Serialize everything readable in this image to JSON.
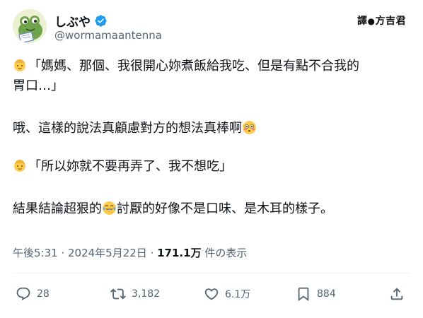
{
  "author": {
    "display_name": "しぶや",
    "handle": "@wormamaantenna",
    "avatar_icon": "frog-reading-avatar",
    "verified_icon": "verified-badge-icon",
    "verified_color": "#1d9bf0"
  },
  "watermark": {
    "prefix": "譯",
    "separator": "●",
    "name": "方吉君"
  },
  "tweet": {
    "line1": "「媽媽、那個、我很開心妳煮飯給我吃、但是有點不合我的",
    "line2": "胃口…」",
    "line3": "哦、這樣的說法真顧慮對方的想法真棒啊",
    "line4": "「所以妳就不要再弄了、我不想吃」",
    "line5a": "結果結論超狠的",
    "line5b": "討厭的好像不是口味、是木耳的樣子。",
    "emoji_child": "child-emoji",
    "emoji_flushed": "flushed-face-emoji",
    "emoji_laugh": "tears-of-joy-emoji"
  },
  "meta": {
    "time": "午後5:31",
    "sep1": " · ",
    "date": "2024年5月22日",
    "sep2": " · ",
    "views_count": "171.1万",
    "views_label": " 件の表示"
  },
  "actions": {
    "reply_count": "28",
    "retweet_count": "3,182",
    "like_count": "6.1万",
    "bookmark_count": "884",
    "reply_icon": "reply-icon",
    "retweet_icon": "retweet-icon",
    "like_icon": "heart-icon",
    "bookmark_icon": "bookmark-icon",
    "share_icon": "share-icon"
  }
}
